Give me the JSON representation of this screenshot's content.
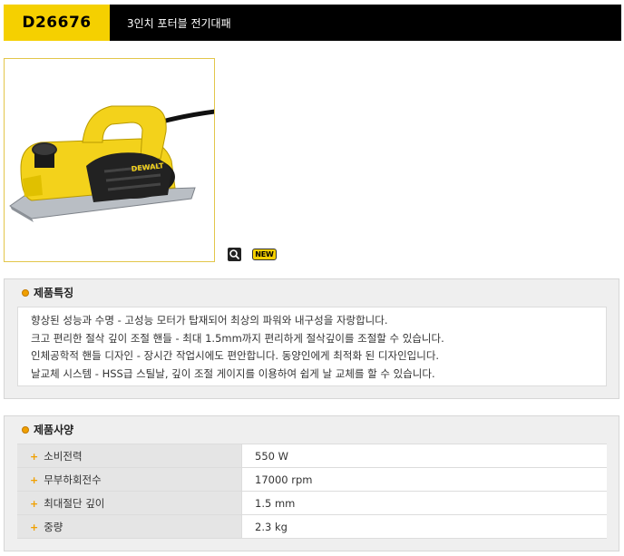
{
  "header": {
    "model": "D26676",
    "title": "3인치 포터블 전기대패"
  },
  "image_actions": {
    "zoom_icon": "magnifier-icon",
    "new_badge": "NEW"
  },
  "features": {
    "heading": "제품특징",
    "lines": [
      "향상된 성능과 수명 - 고성능 모터가 탑재되어 최상의 파워와 내구성을 자랑합니다.",
      "크고 편리한 절삭 깊이 조절 핸들 - 최대 1.5mm까지 편리하게 절삭깊이를 조절할 수 있습니다.",
      "인체공학적 핸들 디자인 - 장시간 작업시에도 편안합니다. 동양인에게 최적화 된 디자인입니다.",
      "날교체 시스템 - HSS급 스틸날, 깊이 조절 게이지를 이용하여 쉽게 날 교체를 할 수 있습니다."
    ]
  },
  "specs": {
    "heading": "제품사양",
    "rows": [
      {
        "label": "소비전력",
        "value": "550 W"
      },
      {
        "label": "무부하회전수",
        "value": "17000 rpm"
      },
      {
        "label": "최대절단 깊이",
        "value": "1.5 mm"
      },
      {
        "label": "중량",
        "value": "2.3 kg"
      }
    ]
  },
  "colors": {
    "accent_yellow": "#f5d000",
    "header_black": "#000000",
    "bullet_orange": "#f0a000"
  }
}
